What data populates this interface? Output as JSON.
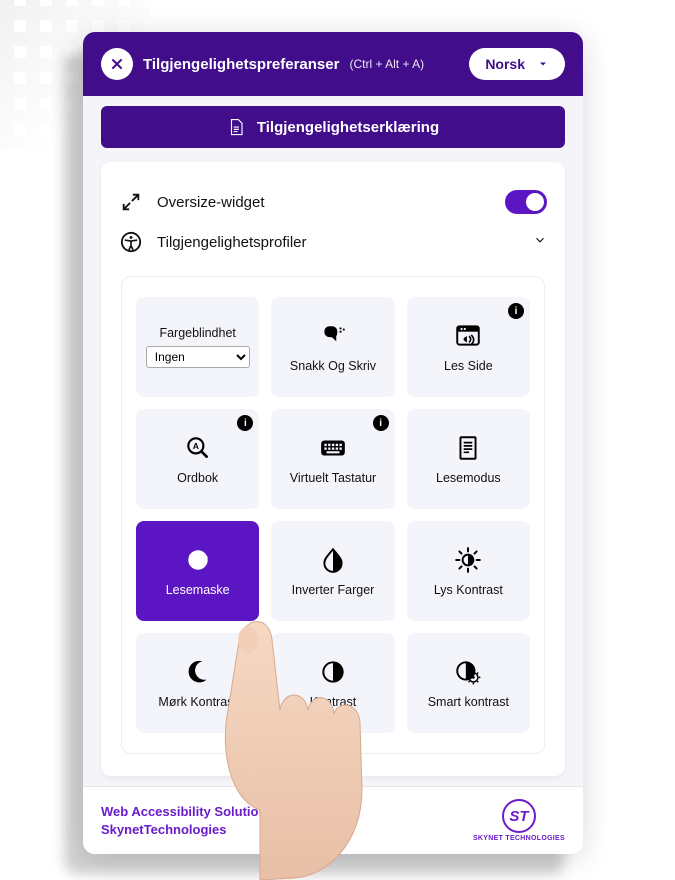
{
  "header": {
    "title": "Tilgjengelighetspreferanser",
    "shortcut": "(Ctrl + Alt + A)",
    "close_label": "Close",
    "language": {
      "selected": "Norsk"
    }
  },
  "declaration": {
    "label": "Tilgjengelighetserklæring"
  },
  "settings": {
    "oversize": {
      "label": "Oversize-widget",
      "enabled": true
    },
    "profiles": {
      "label": "Tilgjengelighetsprofiler"
    }
  },
  "colorblind": {
    "label": "Fargeblindhet",
    "selected": "Ingen",
    "options": [
      "Ingen"
    ]
  },
  "tiles": [
    {
      "id": "colorblind",
      "label": "Fargeblindhet",
      "icon": "colorblind",
      "type": "select"
    },
    {
      "id": "speak-type",
      "label": "Snakk Og Skriv",
      "icon": "speak"
    },
    {
      "id": "read-page",
      "label": "Les Side",
      "icon": "browser-audio",
      "info": true
    },
    {
      "id": "dictionary",
      "label": "Ordbok",
      "icon": "magnify-a",
      "info": true
    },
    {
      "id": "virtual-kbd",
      "label": "Virtuelt Tastatur",
      "icon": "keyboard",
      "info": true
    },
    {
      "id": "read-mode",
      "label": "Lesemodus",
      "icon": "document"
    },
    {
      "id": "read-mask",
      "label": "Lesemaske",
      "icon": "mask",
      "active": true
    },
    {
      "id": "invert",
      "label": "Inverter Farger",
      "icon": "half-drop"
    },
    {
      "id": "light-contrast",
      "label": "Lys Kontrast",
      "icon": "sun"
    },
    {
      "id": "dark-contrast",
      "label": "Mørk Kontrast",
      "icon": "moon"
    },
    {
      "id": "contrast",
      "label": "Kontrast",
      "icon": "half-circle"
    },
    {
      "id": "smart-contrast",
      "label": "Smart kontrast",
      "icon": "half-gear"
    }
  ],
  "footer": {
    "line1": "Web Accessibility Solution By",
    "line2": "SkynetTechnologies",
    "brand_short": "ST",
    "brand_name": "SKYNET TECHNOLOGIES"
  },
  "colors": {
    "accent": "#420d8b",
    "accent2": "#5b15c2"
  }
}
